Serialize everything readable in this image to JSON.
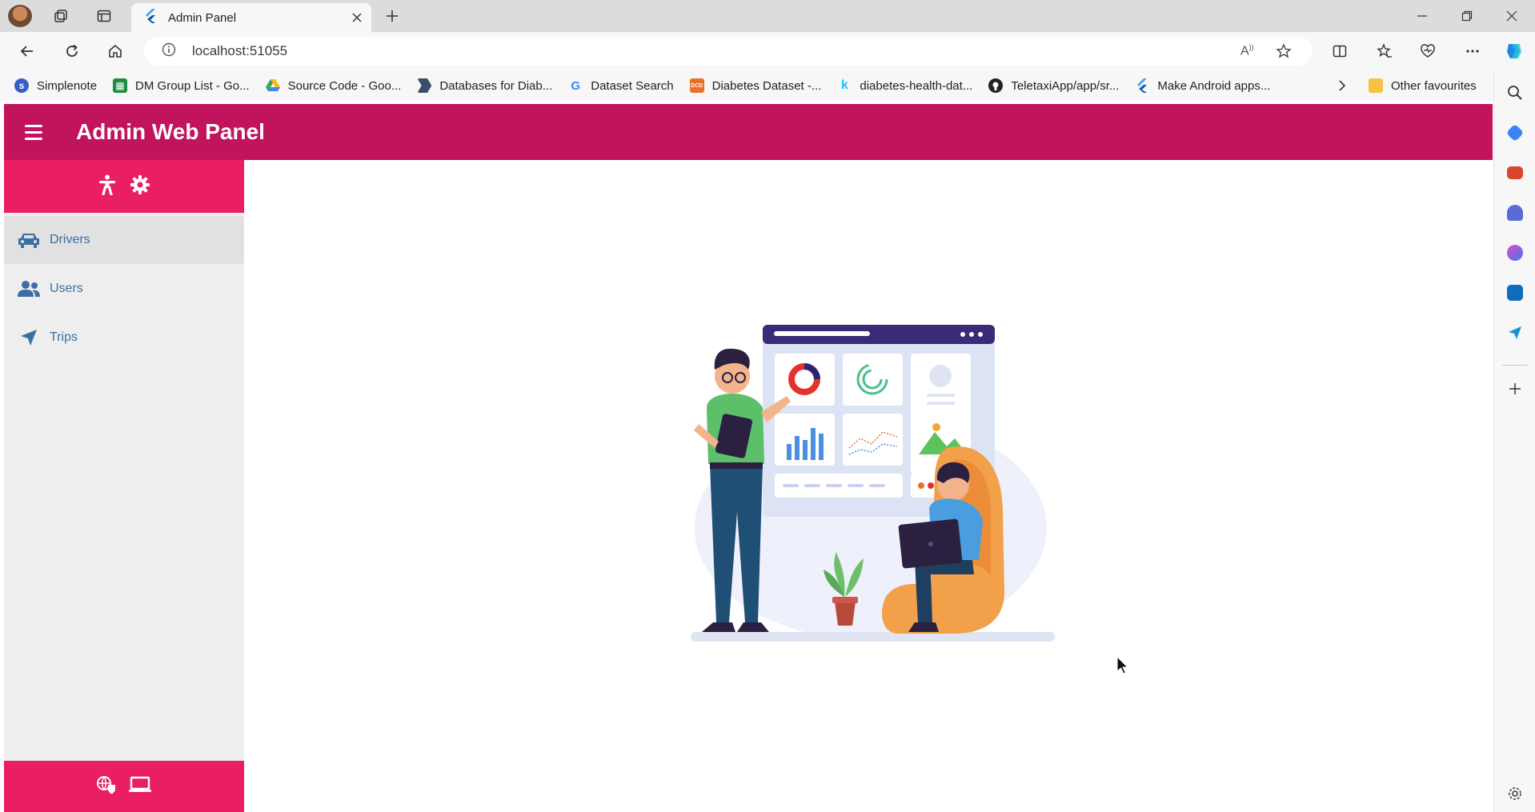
{
  "browser": {
    "tab_title": "Admin Panel",
    "url": "localhost:51055",
    "bookmarks": [
      {
        "label": "Simplenote",
        "icon": "simplenote-icon",
        "color": "#3360c9"
      },
      {
        "label": "DM Group List - Go...",
        "icon": "sheets-icon",
        "color": "#1e8e3e"
      },
      {
        "label": "Source Code - Goo...",
        "icon": "drive-icon",
        "color": "#f4b400"
      },
      {
        "label": "Databases for Diab...",
        "icon": "bookmark-icon",
        "color": "#3c4d6b"
      },
      {
        "label": "Dataset Search",
        "icon": "google-icon",
        "color": "#4285f4"
      },
      {
        "label": "Diabetes Dataset -...",
        "icon": "dcd-icon",
        "color": "#e8702a"
      },
      {
        "label": "diabetes-health-dat...",
        "icon": "kaggle-icon",
        "color": "#20beff"
      },
      {
        "label": "TeletaxiApp/app/sr...",
        "icon": "github-icon",
        "color": "#222222"
      },
      {
        "label": "Make Android apps...",
        "icon": "flutter-icon",
        "color": "#42a5f5"
      }
    ],
    "other_favourites": "Other favourites"
  },
  "app": {
    "title": "Admin Web Panel",
    "colors": {
      "appbar": "#c2145c",
      "drawer_header": "#e91e63",
      "nav_text": "#3b6ea5",
      "drawer_bg": "#eeeeee"
    },
    "nav": [
      {
        "label": "Drivers",
        "icon": "car-icon",
        "selected": true
      },
      {
        "label": "Users",
        "icon": "users-icon",
        "selected": false
      },
      {
        "label": "Trips",
        "icon": "location-arrow-icon",
        "selected": false
      }
    ]
  }
}
